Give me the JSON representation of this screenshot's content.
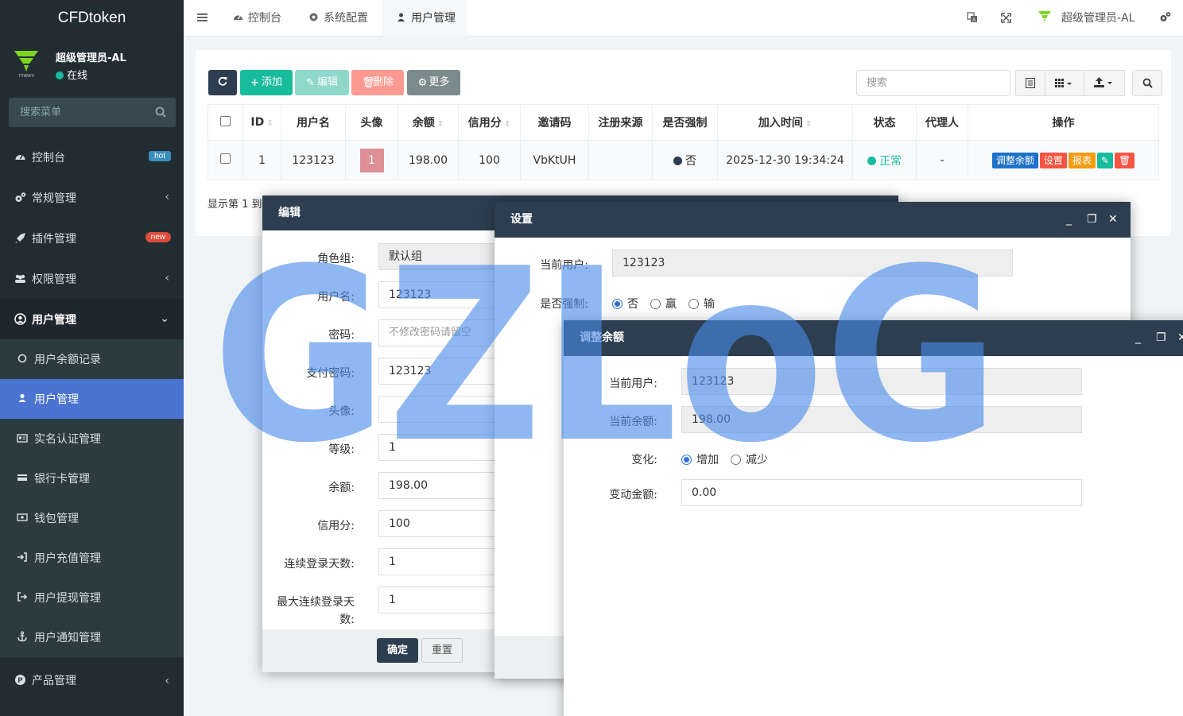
{
  "brand": "CFDtoken",
  "user": {
    "name": "超级管理员-AL",
    "status": "在线"
  },
  "sidebar": {
    "search_placeholder": "搜索菜单",
    "items": [
      {
        "label": "控制台",
        "badge": "hot",
        "badge_color": "#3c8dbc"
      },
      {
        "label": "常规管理"
      },
      {
        "label": "插件管理",
        "badge": "new",
        "badge_color": "#dd4b39"
      },
      {
        "label": "权限管理"
      },
      {
        "label": "用户管理"
      }
    ],
    "sub_items": [
      {
        "label": "用户余额记录"
      },
      {
        "label": "用户管理"
      },
      {
        "label": "实名认证管理"
      },
      {
        "label": "银行卡管理"
      },
      {
        "label": "钱包管理"
      },
      {
        "label": "用户充值管理"
      },
      {
        "label": "用户提现管理"
      },
      {
        "label": "用户通知管理"
      }
    ],
    "bottom_item": {
      "label": "产品管理"
    }
  },
  "header": {
    "tabs": [
      {
        "label": "控制台"
      },
      {
        "label": "系统配置"
      },
      {
        "label": "用户管理"
      }
    ],
    "user": "超级管理员-AL"
  },
  "toolbar": {
    "add": "添加",
    "edit": "编辑",
    "delete": "删除",
    "more": "更多",
    "search_placeholder": "搜索"
  },
  "table": {
    "headers": [
      "ID",
      "用户名",
      "头像",
      "余额",
      "信用分",
      "邀请码",
      "注册来源",
      "是否强制",
      "加入时间",
      "状态",
      "代理人",
      "操作"
    ],
    "row": {
      "id": "1",
      "username": "123123",
      "avatar": "1",
      "balance": "198.00",
      "credit": "100",
      "invite": "VbKtUH",
      "source": "",
      "forced": "否",
      "joined": "2025-12-30 19:34:24",
      "status": "正常",
      "agent": "-"
    },
    "ops": [
      "调整余额",
      "设置",
      "报表"
    ],
    "showing": "显示第 1 到"
  },
  "edit_dialog": {
    "title": "编辑",
    "fields": [
      {
        "label": "角色组:",
        "value": "默认组"
      },
      {
        "label": "用户名:",
        "value": "123123"
      },
      {
        "label": "密码:",
        "value": "",
        "placeholder": "不修改密码请留空"
      },
      {
        "label": "支付密码:",
        "value": "123123"
      },
      {
        "label": "头像:",
        "value": ""
      },
      {
        "label": "等级:",
        "value": "1"
      },
      {
        "label": "余额:",
        "value": "198.00"
      },
      {
        "label": "信用分:",
        "value": "100"
      },
      {
        "label": "连续登录天数:",
        "value": "1"
      },
      {
        "label": "最大连续登录天",
        "label2": "数:",
        "value": "1"
      }
    ],
    "ok": "确定",
    "reset": "重置"
  },
  "settings_dialog": {
    "title": "设置",
    "current_user_label": "当前用户:",
    "current_user": "123123",
    "forced_label": "是否强制:",
    "options": [
      "否",
      "赢",
      "输"
    ]
  },
  "balance_dialog": {
    "title": "调整余额",
    "current_user_label": "当前用户:",
    "current_user": "123123",
    "current_balance_label": "当前余额:",
    "current_balance": "198.00",
    "change_label": "变化:",
    "change_options": [
      "增加",
      "减少"
    ],
    "amount_label": "变动金额:",
    "amount": "0.00"
  },
  "watermark": "GZLoG",
  "colors": {
    "sidebar_bg": "#222d32",
    "active_blue": "#4b73d1",
    "dialog_title": "#2c3e50",
    "success": "#18bc9c",
    "danger": "#f75444",
    "warning": "#f39c12",
    "primary": "#3c8dbc"
  }
}
